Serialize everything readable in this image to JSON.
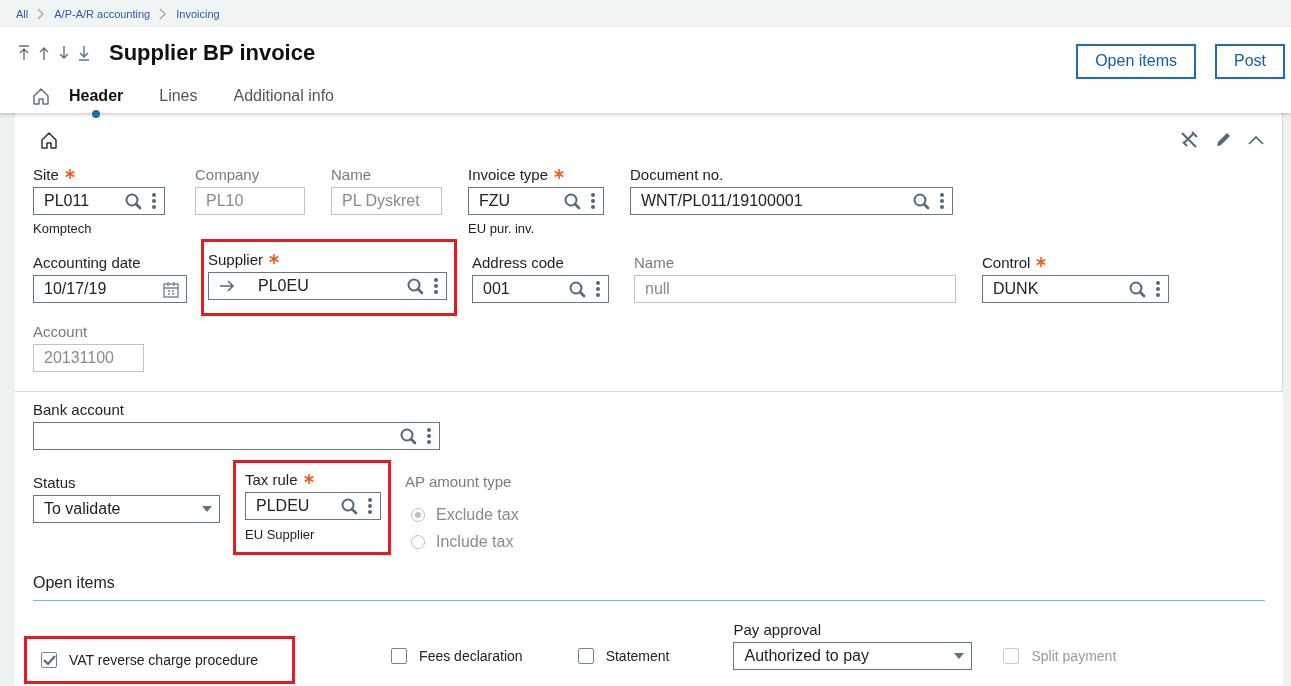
{
  "breadcrumb": [
    {
      "label": "All"
    },
    {
      "label": "A/P-A/R accounting"
    },
    {
      "label": "Invoicing"
    }
  ],
  "page": {
    "title": "Supplier BP invoice"
  },
  "actions": [
    {
      "label": "Open items"
    },
    {
      "label": "Post"
    }
  ],
  "tabs": [
    {
      "label": "Header",
      "selected": true
    },
    {
      "label": "Lines",
      "selected": false
    },
    {
      "label": "Additional info",
      "selected": false
    }
  ],
  "header_card": {
    "field_groups": [
      {
        "fields": [
          {
            "label": "Site",
            "required": true,
            "kind": "lookup",
            "value": "PL011",
            "disabled": false,
            "note": "Komptech",
            "highlighted": false
          },
          {
            "label": "Company",
            "required": false,
            "kind": "text",
            "value": "PL10",
            "disabled": true,
            "highlighted": false
          },
          {
            "label": "Name",
            "required": false,
            "kind": "text",
            "value": "PL Dyskret",
            "disabled": true,
            "highlighted": false
          },
          {
            "label": "Invoice type",
            "required": true,
            "kind": "lookup",
            "value": "FZU",
            "disabled": false,
            "note": "EU pur. inv.",
            "highlighted": false
          },
          {
            "label": "Document no.",
            "required": false,
            "kind": "lookup",
            "value": "WNT/PL011/19100001",
            "disabled": false,
            "highlighted": false
          }
        ]
      },
      {
        "fields": [
          {
            "label": "Accounting date",
            "required": false,
            "kind": "date",
            "value": "10/17/19",
            "disabled": false,
            "highlighted": false
          },
          {
            "label": "Supplier",
            "required": true,
            "kind": "link",
            "value": "PL0EU",
            "disabled": false,
            "highlighted": true
          },
          {
            "label": "Address code",
            "required": false,
            "kind": "lookup",
            "value": "001",
            "disabled": false,
            "highlighted": false
          },
          {
            "label": "Name",
            "required": false,
            "kind": "text",
            "value": "null",
            "disabled": true,
            "highlighted": false
          },
          {
            "label": "Control",
            "required": true,
            "kind": "lookup",
            "value": "DUNK",
            "disabled": false,
            "highlighted": false
          }
        ]
      },
      {
        "fields": [
          {
            "label": "Account",
            "required": false,
            "kind": "text",
            "value": "20131100",
            "disabled": true,
            "highlighted": false
          }
        ]
      }
    ]
  },
  "section": {
    "bank_account": {
      "label": "Bank account",
      "required": false,
      "kind": "lookup",
      "disabled": false,
      "highlighted": false
    },
    "status": {
      "label": "Status",
      "required": false,
      "kind": "select",
      "value": "To validate",
      "disabled": false,
      "highlighted": false
    },
    "tax_rule": {
      "label": "Tax rule",
      "required": true,
      "kind": "lookup",
      "value": "PLDEU",
      "disabled": false,
      "note": "EU Supplier",
      "highlighted": true
    },
    "ap_amount_type": {
      "label": "AP amount type",
      "disabled": true,
      "options": [
        {
          "label": "Exclude tax",
          "selected": true
        },
        {
          "label": "Include tax",
          "selected": false
        }
      ]
    },
    "open_items": {
      "title": "Open items",
      "items": [
        {
          "kind": "checkbox",
          "label": "VAT reverse charge procedure",
          "checked": true,
          "disabled": false,
          "highlighted": true
        },
        {
          "kind": "checkbox",
          "label": "Fees declaration",
          "checked": false,
          "disabled": false,
          "highlighted": false
        },
        {
          "kind": "checkbox",
          "label": "Statement",
          "checked": false,
          "disabled": false,
          "highlighted": false
        },
        {
          "kind": "select",
          "label": "Pay approval",
          "value": "Authorized to pay",
          "disabled": false,
          "highlighted": false
        },
        {
          "kind": "checkbox",
          "label": "Split payment",
          "checked": false,
          "disabled": true,
          "highlighted": false
        }
      ]
    }
  }
}
